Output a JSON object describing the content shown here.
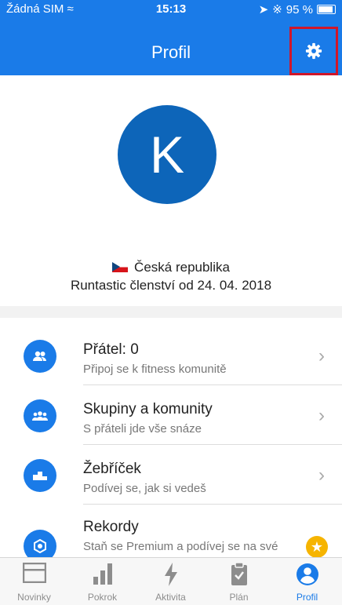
{
  "status_bar": {
    "carrier": "Žádná SIM",
    "time": "15:13",
    "battery": "95 %"
  },
  "header": {
    "title": "Profil"
  },
  "profile": {
    "avatar_letter": "K",
    "country": "Česká republika",
    "membership": "Runtastic členství od 24. 04. 2018"
  },
  "menu": [
    {
      "title": "Přátel: 0",
      "subtitle": "Připoj se k fitness komunitě",
      "icon": "friends-icon"
    },
    {
      "title": "Skupiny a komunity",
      "subtitle": "S přáteli jde vše snáze",
      "icon": "groups-icon"
    },
    {
      "title": "Žebříček",
      "subtitle": "Podívej se, jak si vedeš",
      "icon": "leaderboard-icon"
    },
    {
      "title": "Rekordy",
      "subtitle": "Staň se Premium a podívej se na své",
      "icon": "records-icon"
    }
  ],
  "tabs": [
    {
      "label": "Novinky",
      "icon": "news-icon"
    },
    {
      "label": "Pokrok",
      "icon": "progress-icon"
    },
    {
      "label": "Aktivita",
      "icon": "activity-icon"
    },
    {
      "label": "Plán",
      "icon": "plan-icon"
    },
    {
      "label": "Profil",
      "icon": "profile-icon"
    }
  ],
  "colors": {
    "accent": "#1a7be8",
    "avatar": "#0d65b9",
    "highlight": "#d0162a",
    "premium": "#f6b400"
  }
}
